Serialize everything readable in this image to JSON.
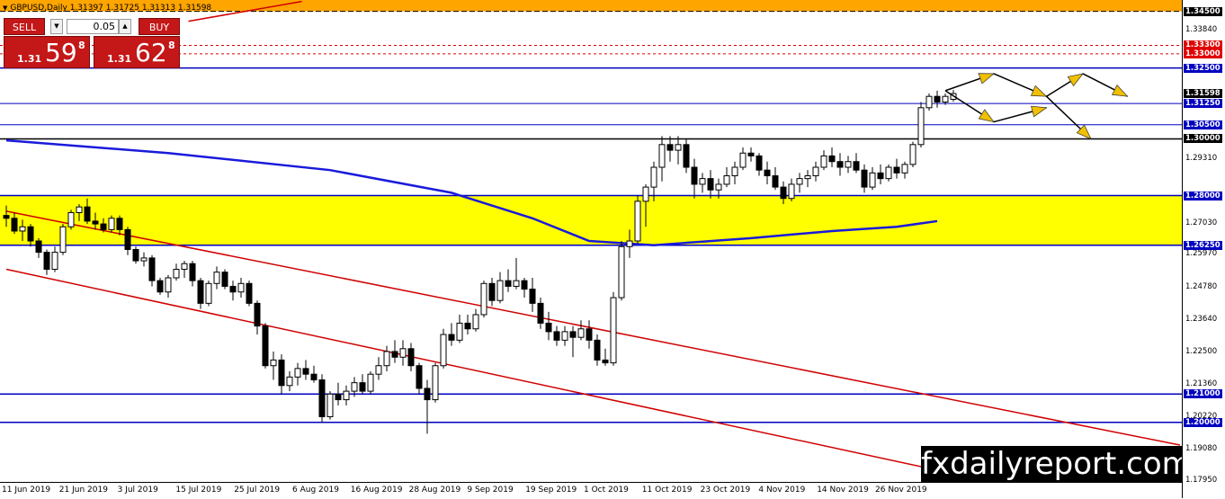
{
  "header": {
    "symbol_title": "GBPUSD,Daily  1.31397 1.31725 1.31313 1.31598",
    "arrow_icon": "triangle-down-icon"
  },
  "trade_panel": {
    "sell_label": "SELL",
    "buy_label": "BUY",
    "lot_value": "0.05",
    "step_down_icon": "chevron-down-icon",
    "step_up_icon": "chevron-up-icon",
    "sell_quote": {
      "small": "1.31",
      "big": "59",
      "sup": "8"
    },
    "buy_quote": {
      "small": "1.31",
      "big": "62",
      "sup": "8"
    },
    "color": "#c41718"
  },
  "price_axis": {
    "ticks": [
      "1.33840",
      "1.31598",
      "1.29310",
      "1.27030",
      "1.25970",
      "1.24780",
      "1.23640",
      "1.22500",
      "1.21360",
      "1.20220",
      "1.19080",
      "1.17950"
    ],
    "level_labels": [
      {
        "text": "1.34500",
        "style": "dark"
      },
      {
        "text": "1.33300",
        "style": "red"
      },
      {
        "text": "1.33000",
        "style": "red"
      },
      {
        "text": "1.32500",
        "style": "blue"
      },
      {
        "text": "1.31598",
        "style": "dark"
      },
      {
        "text": "1.31250",
        "style": "blue"
      },
      {
        "text": "1.30500",
        "style": "blue"
      },
      {
        "text": "1.30000",
        "style": "dark"
      },
      {
        "text": "1.28000",
        "style": "blue"
      },
      {
        "text": "1.26250",
        "style": "blue"
      },
      {
        "text": "1.21000",
        "style": "blue"
      },
      {
        "text": "1.20000",
        "style": "blue"
      }
    ]
  },
  "time_axis": {
    "labels": [
      "11 Jun 2019",
      "21 Jun 2019",
      "3 Jul 2019",
      "15 Jul 2019",
      "25 Jul 2019",
      "6 Aug 2019",
      "16 Aug 2019",
      "28 Aug 2019",
      "9 Sep 2019",
      "19 Sep 2019",
      "1 Oct 2019",
      "11 Oct 2019",
      "23 Oct 2019",
      "4 Nov 2019",
      "14 Nov 2019",
      "26 Nov 2019"
    ]
  },
  "chart_data": {
    "type": "candlestick",
    "symbol": "GBPUSD",
    "timeframe": "Daily",
    "last_ohlc": {
      "open": 1.31397,
      "high": 1.31725,
      "low": 1.31313,
      "close": 1.31598
    },
    "candles": [
      [
        1.273,
        1.2765,
        1.269,
        1.272
      ],
      [
        1.272,
        1.274,
        1.2665,
        1.2675
      ],
      [
        1.2675,
        1.2715,
        1.264,
        1.269
      ],
      [
        1.269,
        1.27,
        1.262,
        1.264
      ],
      [
        1.264,
        1.265,
        1.258,
        1.26
      ],
      [
        1.26,
        1.261,
        1.252,
        1.254
      ],
      [
        1.254,
        1.262,
        1.253,
        1.26
      ],
      [
        1.26,
        1.27,
        1.259,
        1.269
      ],
      [
        1.269,
        1.275,
        1.268,
        1.274
      ],
      [
        1.274,
        1.277,
        1.271,
        1.276
      ],
      [
        1.276,
        1.279,
        1.27,
        1.271
      ],
      [
        1.271,
        1.274,
        1.268,
        1.27
      ],
      [
        1.27,
        1.272,
        1.267,
        1.268
      ],
      [
        1.268,
        1.273,
        1.267,
        1.272
      ],
      [
        1.272,
        1.273,
        1.266,
        1.268
      ],
      [
        1.268,
        1.269,
        1.259,
        1.261
      ],
      [
        1.261,
        1.262,
        1.256,
        1.257
      ],
      [
        1.257,
        1.26,
        1.255,
        1.258
      ],
      [
        1.258,
        1.259,
        1.248,
        1.25
      ],
      [
        1.25,
        1.251,
        1.245,
        1.246
      ],
      [
        1.246,
        1.252,
        1.244,
        1.251
      ],
      [
        1.251,
        1.256,
        1.25,
        1.254
      ],
      [
        1.254,
        1.257,
        1.251,
        1.256
      ],
      [
        1.256,
        1.257,
        1.248,
        1.25
      ],
      [
        1.25,
        1.251,
        1.24,
        1.242
      ],
      [
        1.242,
        1.25,
        1.241,
        1.249
      ],
      [
        1.249,
        1.255,
        1.247,
        1.253
      ],
      [
        1.253,
        1.254,
        1.247,
        1.248
      ],
      [
        1.248,
        1.25,
        1.243,
        1.246
      ],
      [
        1.246,
        1.251,
        1.244,
        1.249
      ],
      [
        1.249,
        1.25,
        1.241,
        1.242
      ],
      [
        1.242,
        1.243,
        1.231,
        1.234
      ],
      [
        1.234,
        1.235,
        1.219,
        1.22
      ],
      [
        1.22,
        1.225,
        1.215,
        1.222
      ],
      [
        1.222,
        1.224,
        1.21,
        1.213
      ],
      [
        1.213,
        1.218,
        1.211,
        1.216
      ],
      [
        1.216,
        1.221,
        1.213,
        1.219
      ],
      [
        1.219,
        1.222,
        1.215,
        1.217
      ],
      [
        1.217,
        1.22,
        1.214,
        1.215
      ],
      [
        1.215,
        1.217,
        1.2,
        1.202
      ],
      [
        1.202,
        1.211,
        1.201,
        1.21
      ],
      [
        1.21,
        1.214,
        1.206,
        1.208
      ],
      [
        1.208,
        1.213,
        1.206,
        1.211
      ],
      [
        1.211,
        1.216,
        1.209,
        1.214
      ],
      [
        1.214,
        1.217,
        1.21,
        1.211
      ],
      [
        1.211,
        1.218,
        1.21,
        1.217
      ],
      [
        1.217,
        1.223,
        1.215,
        1.22
      ],
      [
        1.22,
        1.227,
        1.218,
        1.225
      ],
      [
        1.225,
        1.229,
        1.221,
        1.223
      ],
      [
        1.223,
        1.229,
        1.22,
        1.226
      ],
      [
        1.226,
        1.228,
        1.218,
        1.22
      ],
      [
        1.22,
        1.221,
        1.21,
        1.212
      ],
      [
        1.212,
        1.215,
        1.196,
        1.208
      ],
      [
        1.208,
        1.221,
        1.207,
        1.22
      ],
      [
        1.22,
        1.233,
        1.219,
        1.231
      ],
      [
        1.231,
        1.235,
        1.227,
        1.229
      ],
      [
        1.229,
        1.238,
        1.228,
        1.235
      ],
      [
        1.235,
        1.238,
        1.231,
        1.233
      ],
      [
        1.233,
        1.24,
        1.232,
        1.238
      ],
      [
        1.238,
        1.25,
        1.237,
        1.249
      ],
      [
        1.249,
        1.251,
        1.241,
        1.243
      ],
      [
        1.243,
        1.253,
        1.242,
        1.25
      ],
      [
        1.25,
        1.254,
        1.246,
        1.248
      ],
      [
        1.248,
        1.258,
        1.247,
        1.25
      ],
      [
        1.25,
        1.251,
        1.244,
        1.247
      ],
      [
        1.247,
        1.251,
        1.239,
        1.242
      ],
      [
        1.242,
        1.244,
        1.233,
        1.235
      ],
      [
        1.235,
        1.239,
        1.229,
        1.232
      ],
      [
        1.232,
        1.234,
        1.227,
        1.229
      ],
      [
        1.229,
        1.234,
        1.227,
        1.232
      ],
      [
        1.232,
        1.234,
        1.223,
        1.23
      ],
      [
        1.23,
        1.236,
        1.229,
        1.233
      ],
      [
        1.233,
        1.236,
        1.226,
        1.229
      ],
      [
        1.229,
        1.231,
        1.22,
        1.222
      ],
      [
        1.222,
        1.226,
        1.22,
        1.221
      ],
      [
        1.221,
        1.246,
        1.22,
        1.244
      ],
      [
        1.244,
        1.264,
        1.243,
        1.262
      ],
      [
        1.262,
        1.268,
        1.258,
        1.264
      ],
      [
        1.264,
        1.28,
        1.263,
        1.278
      ],
      [
        1.278,
        1.284,
        1.269,
        1.283
      ],
      [
        1.283,
        1.292,
        1.278,
        1.29
      ],
      [
        1.29,
        1.301,
        1.285,
        1.298
      ],
      [
        1.298,
        1.301,
        1.292,
        1.296
      ],
      [
        1.296,
        1.301,
        1.291,
        1.298
      ],
      [
        1.298,
        1.3,
        1.288,
        1.29
      ],
      [
        1.29,
        1.293,
        1.279,
        1.284
      ],
      [
        1.284,
        1.288,
        1.281,
        1.286
      ],
      [
        1.286,
        1.289,
        1.279,
        1.282
      ],
      [
        1.282,
        1.286,
        1.279,
        1.284
      ],
      [
        1.284,
        1.29,
        1.283,
        1.287
      ],
      [
        1.287,
        1.292,
        1.284,
        1.29
      ],
      [
        1.29,
        1.297,
        1.289,
        1.295
      ],
      [
        1.295,
        1.297,
        1.292,
        1.294
      ],
      [
        1.294,
        1.295,
        1.287,
        1.289
      ],
      [
        1.289,
        1.292,
        1.284,
        1.287
      ],
      [
        1.287,
        1.29,
        1.282,
        1.283
      ],
      [
        1.283,
        1.285,
        1.277,
        1.279
      ],
      [
        1.279,
        1.286,
        1.278,
        1.284
      ],
      [
        1.284,
        1.288,
        1.281,
        1.286
      ],
      [
        1.286,
        1.289,
        1.283,
        1.287
      ],
      [
        1.287,
        1.292,
        1.285,
        1.29
      ],
      [
        1.29,
        1.296,
        1.289,
        1.294
      ],
      [
        1.294,
        1.297,
        1.29,
        1.292
      ],
      [
        1.292,
        1.295,
        1.287,
        1.29
      ],
      [
        1.29,
        1.294,
        1.288,
        1.292
      ],
      [
        1.292,
        1.295,
        1.288,
        1.289
      ],
      [
        1.289,
        1.291,
        1.281,
        1.283
      ],
      [
        1.283,
        1.29,
        1.282,
        1.288
      ],
      [
        1.288,
        1.291,
        1.284,
        1.286
      ],
      [
        1.286,
        1.291,
        1.285,
        1.29
      ],
      [
        1.29,
        1.293,
        1.286,
        1.288
      ],
      [
        1.288,
        1.292,
        1.286,
        1.291
      ],
      [
        1.291,
        1.299,
        1.29,
        1.298
      ],
      [
        1.298,
        1.313,
        1.297,
        1.311
      ],
      [
        1.311,
        1.316,
        1.31,
        1.315
      ],
      [
        1.315,
        1.317,
        1.311,
        1.313
      ],
      [
        1.313,
        1.316,
        1.312,
        1.315
      ],
      [
        1.31397,
        1.31725,
        1.31313,
        1.31598
      ]
    ],
    "horizontal_levels": [
      {
        "price": 1.345,
        "color": "#000000",
        "style": "dashed"
      },
      {
        "price": 1.333,
        "color": "#e00000",
        "style": "dotted"
      },
      {
        "price": 1.33,
        "color": "#e00000",
        "style": "dotted"
      },
      {
        "price": 1.325,
        "color": "#0000c0",
        "style": "solid"
      },
      {
        "price": 1.3125,
        "color": "#0000c0",
        "style": "thin"
      },
      {
        "price": 1.305,
        "color": "#0000c0",
        "style": "thin"
      },
      {
        "price": 1.3,
        "color": "#000000",
        "style": "solid"
      },
      {
        "price": 1.28,
        "color": "#0000c0",
        "style": "solid"
      },
      {
        "price": 1.2625,
        "color": "#0000c0",
        "style": "solid"
      },
      {
        "price": 1.21,
        "color": "#0000c0",
        "style": "solid"
      },
      {
        "price": 1.2,
        "color": "#0000c0",
        "style": "solid"
      }
    ],
    "zones": [
      {
        "from": 1.345,
        "to": 1.349,
        "color": "#ffa500"
      },
      {
        "from": 1.2625,
        "to": 1.28,
        "color": "#ffff00"
      }
    ],
    "moving_average": {
      "color": "#1a1adc",
      "points": [
        [
          0,
          1.2995
        ],
        [
          20,
          1.295
        ],
        [
          40,
          1.289
        ],
        [
          55,
          1.281
        ],
        [
          65,
          1.272
        ],
        [
          72,
          1.264
        ],
        [
          80,
          1.2625
        ],
        [
          92,
          1.265
        ],
        [
          102,
          1.2675
        ],
        [
          110,
          1.269
        ],
        [
          115,
          1.271
        ]
      ]
    },
    "trend_lines": [
      {
        "color": "#d00000",
        "from": [
          0,
          1.2745
        ],
        "to": [
          145,
          1.192
        ]
      },
      {
        "color": "#d00000",
        "from": [
          0,
          1.254
        ],
        "to": [
          125,
          1.177
        ]
      },
      {
        "color": "#d00000",
        "from": [
          22.5,
          1.3415
        ],
        "to": [
          36.5,
          1.3485
        ]
      }
    ],
    "projection_arrows": {
      "line_color": "#000000",
      "head_color": "#f0c000",
      "segments": [
        [
          [
            116,
            1.317
          ],
          [
            122,
            1.323
          ]
        ],
        [
          [
            122,
            1.323
          ],
          [
            128.5,
            1.315
          ]
        ],
        [
          [
            116,
            1.317
          ],
          [
            122,
            1.306
          ]
        ],
        [
          [
            122,
            1.306
          ],
          [
            128.5,
            1.311
          ]
        ],
        [
          [
            128.5,
            1.315
          ],
          [
            133,
            1.323
          ]
        ],
        [
          [
            133,
            1.323
          ],
          [
            138.5,
            1.315
          ]
        ],
        [
          [
            128.5,
            1.315
          ],
          [
            134,
            1.3
          ]
        ]
      ]
    },
    "ylim": [
      1.179,
      1.349
    ]
  },
  "watermark": "fxdailyreport.com"
}
